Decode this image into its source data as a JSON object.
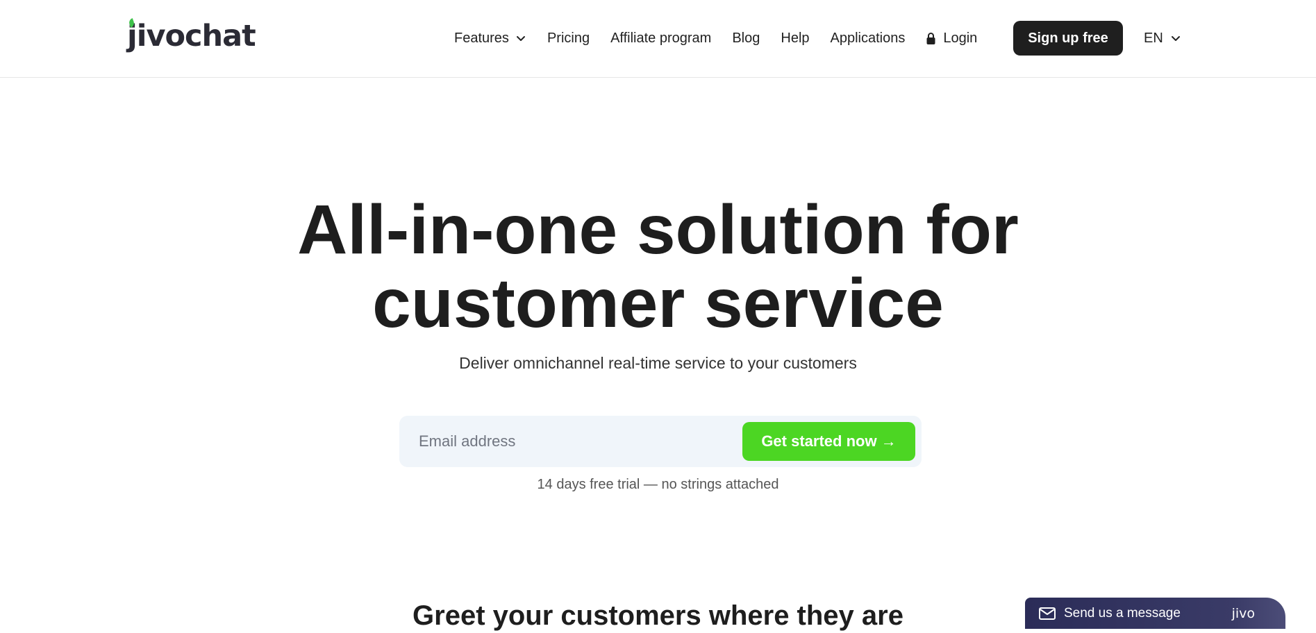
{
  "header": {
    "logo_text": "jivochat",
    "nav": {
      "features": "Features",
      "pricing": "Pricing",
      "affiliate": "Affiliate program",
      "blog": "Blog",
      "help": "Help",
      "applications": "Applications",
      "login": "Login"
    },
    "signup_label": "Sign up free",
    "language": "EN"
  },
  "hero": {
    "title_line1": "All-in-one solution for",
    "title_line2": "customer service",
    "subtitle": "Deliver omnichannel real-time service to your customers",
    "email_placeholder": "Email address",
    "email_value": "",
    "cta_label": "Get started now →",
    "trial_note": "14 days free trial — no strings attached"
  },
  "section": {
    "title": "Greet your customers where they are"
  },
  "chat_widget": {
    "label": "Send us a message",
    "brand": "jivo"
  },
  "colors": {
    "cta": "#4cd623",
    "signup_bg": "#1f1f1f",
    "logo_leaf": "#3ec24a",
    "input_bg": "#f0f5fa",
    "widget_bg": "#2b2c58"
  },
  "icons": {
    "features_dropdown": "chevron-down-icon",
    "login": "lock-icon",
    "language_dropdown": "chevron-down-icon",
    "chat": "envelope-icon"
  }
}
